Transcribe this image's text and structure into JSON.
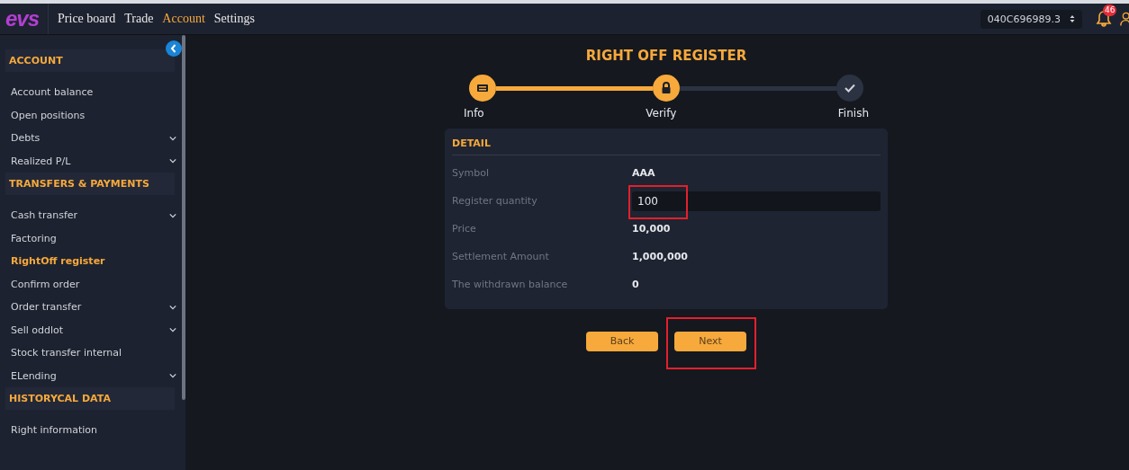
{
  "nav": {
    "logo": "evs",
    "items": [
      {
        "label": "Price board",
        "selected": false
      },
      {
        "label": "Trade",
        "selected": false
      },
      {
        "label": "Account",
        "selected": true
      },
      {
        "label": "Settings",
        "selected": false
      }
    ],
    "account": "040C696989.3",
    "notifications": "46"
  },
  "sidebar": {
    "sections": [
      {
        "title": "ACCOUNT",
        "items": [
          {
            "label": "Account balance",
            "selected": false,
            "expandable": false
          },
          {
            "label": "Open positions",
            "selected": false,
            "expandable": false
          },
          {
            "label": "Debts",
            "selected": false,
            "expandable": true
          },
          {
            "label": "Realized P/L",
            "selected": false,
            "expandable": true
          }
        ]
      },
      {
        "title": "TRANSFERS & PAYMENTS",
        "items": [
          {
            "label": "Cash transfer",
            "selected": false,
            "expandable": true
          },
          {
            "label": "Factoring",
            "selected": false,
            "expandable": false
          },
          {
            "label": "RightOff register",
            "selected": true,
            "expandable": false
          },
          {
            "label": "Confirm order",
            "selected": false,
            "expandable": false
          },
          {
            "label": "Order transfer",
            "selected": false,
            "expandable": true
          },
          {
            "label": "Sell oddlot",
            "selected": false,
            "expandable": true
          },
          {
            "label": "Stock transfer internal",
            "selected": false,
            "expandable": false
          },
          {
            "label": "ELending",
            "selected": false,
            "expandable": true
          }
        ]
      },
      {
        "title": "HISTORYCAL DATA",
        "items": [
          {
            "label": "Right information",
            "selected": false,
            "expandable": false
          }
        ]
      }
    ]
  },
  "page": {
    "title": "RIGHT OFF REGISTER",
    "steps": [
      {
        "label": "Info",
        "kind": "keyboard",
        "reached": true
      },
      {
        "label": "Verify",
        "kind": "lock",
        "reached": true
      },
      {
        "label": "Finish",
        "kind": "check",
        "reached": false
      }
    ],
    "detail": {
      "title": "DETAIL",
      "rows": [
        {
          "label": "Symbol",
          "value": "AAA",
          "kind": "text",
          "highlighted": false
        },
        {
          "label": "Register quantity",
          "value": "100",
          "kind": "input",
          "highlighted": true
        },
        {
          "label": "Price",
          "value": "10,000",
          "kind": "text",
          "highlighted": false
        },
        {
          "label": "Settlement Amount",
          "value": "1,000,000",
          "kind": "text",
          "highlighted": false
        },
        {
          "label": "The withdrawn balance",
          "value": "0",
          "kind": "text",
          "highlighted": false
        }
      ]
    },
    "buttons": [
      {
        "label": "Back",
        "highlighted": false
      },
      {
        "label": "Next",
        "highlighted": true
      }
    ]
  }
}
